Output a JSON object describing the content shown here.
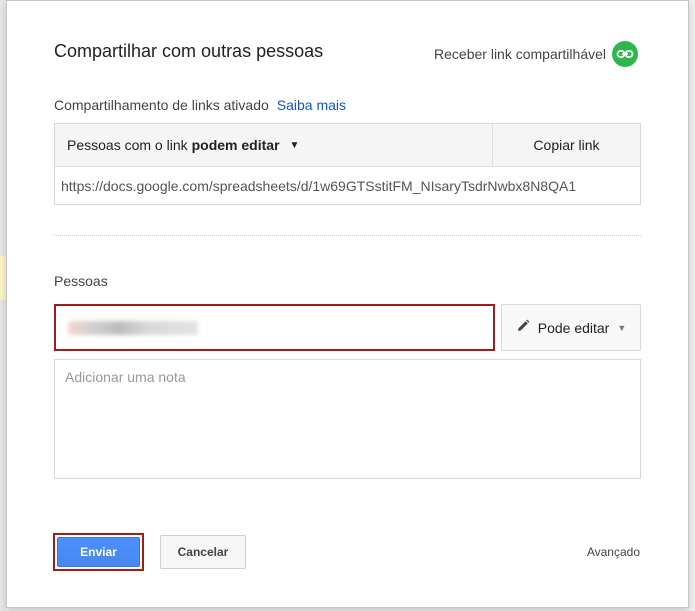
{
  "dialog": {
    "title": "Compartilhar com outras pessoas",
    "get_link_label": "Receber link compartilhável",
    "link_sharing_status": "Compartilhamento de links ativado",
    "learn_more": "Saiba mais",
    "link_permission_prefix": "Pessoas com o link",
    "link_permission_value": "podem editar",
    "copy_link": "Copiar link",
    "share_url": "https://docs.google.com/spreadsheets/d/1w69GTSstitFM_NIsaryTsdrNwbx8N8QA1",
    "people_label": "Pessoas",
    "people_permission": "Pode editar",
    "note_placeholder": "Adicionar uma nota",
    "send": "Enviar",
    "cancel": "Cancelar",
    "advanced": "Avançado"
  },
  "colors": {
    "accent_blue": "#4d90fe",
    "link_green": "#2db84d",
    "highlight_red": "#a31b1b"
  }
}
